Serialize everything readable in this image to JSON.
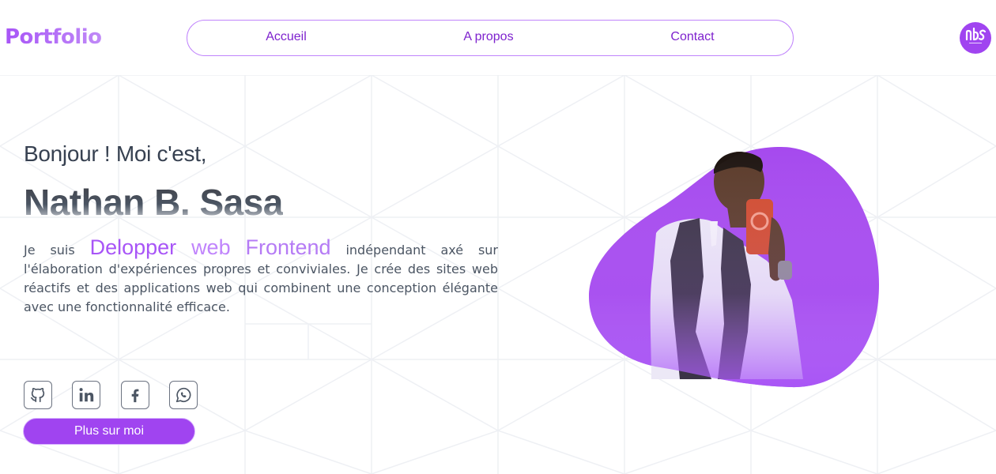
{
  "header": {
    "logo": "Portfolio",
    "nav": [
      {
        "label": "Accueil"
      },
      {
        "label": "A propos"
      },
      {
        "label": "Contact"
      }
    ],
    "avatar_text": "NBS"
  },
  "hero": {
    "greeting": "Bonjour ! Moi c'est,",
    "name": "Nathan B. Sasa",
    "bio_prefix": "Je suis",
    "bio_highlight_1": "Delopper",
    "bio_highlight_2": "web",
    "bio_highlight_3": "Frontend",
    "bio_suffix": "indépendant axé sur l'élaboration d'expériences propres et conviviales. Je crée des sites web réactifs et des applications web qui combinent une conception élégante avec une fonctionnalité efficace.",
    "socials": [
      {
        "icon": "github-icon"
      },
      {
        "icon": "linkedin-icon"
      },
      {
        "icon": "facebook-icon"
      },
      {
        "icon": "whatsapp-icon"
      }
    ],
    "cta_label": "Plus sur moi"
  },
  "colors": {
    "accent": "#a855f7",
    "button": "#a044f0",
    "nav_text": "#7e22ce",
    "text": "#4b5563"
  }
}
